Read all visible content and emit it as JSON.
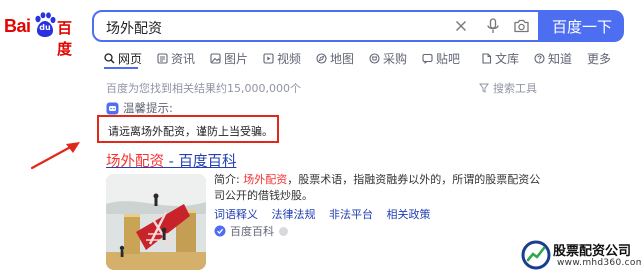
{
  "logo": {
    "latin": "Bai",
    "paw_text": "du",
    "chinese": "百度"
  },
  "search": {
    "query": "场外配资",
    "button_label": "百度一下"
  },
  "tabs": [
    {
      "label": "网页",
      "icon": "search-icon",
      "active": true
    },
    {
      "label": "资讯",
      "icon": "news-icon"
    },
    {
      "label": "图片",
      "icon": "image-icon"
    },
    {
      "label": "视频",
      "icon": "video-icon"
    },
    {
      "label": "地图",
      "icon": "map-icon"
    },
    {
      "label": "采购",
      "icon": "cart-icon"
    },
    {
      "label": "贴吧",
      "icon": "tieba-icon"
    },
    {
      "label": "文库",
      "icon": "doc-icon"
    },
    {
      "label": "知道",
      "icon": "question-icon"
    },
    {
      "label": "更多"
    }
  ],
  "results_count": "百度为您找到相关结果约15,000,000个",
  "search_tools": "搜索工具",
  "tip": {
    "title": "温馨提示:",
    "warning": "请远离场外配资，谨防上当受骗。"
  },
  "result": {
    "title_highlight": "场外配资",
    "title_rest": " - 百度百科",
    "summary_prefix": "简介: ",
    "summary_highlight": "场外配资",
    "summary_rest": "，股票术语，指融资融券以外的，所谓的股票配资公司公开的借钱炒股。",
    "links": [
      "词语释义",
      "法律法规",
      "非法平台",
      "相关政策"
    ],
    "source": "百度百科"
  },
  "watermark": {
    "title": "股票配资公司",
    "url": "www.mhd360.com"
  },
  "colors": {
    "accent": "#4e6ef2",
    "brand": "#e10601",
    "link": "#2440b3",
    "highlight": "#f73131",
    "warning_border": "#e0281b"
  }
}
